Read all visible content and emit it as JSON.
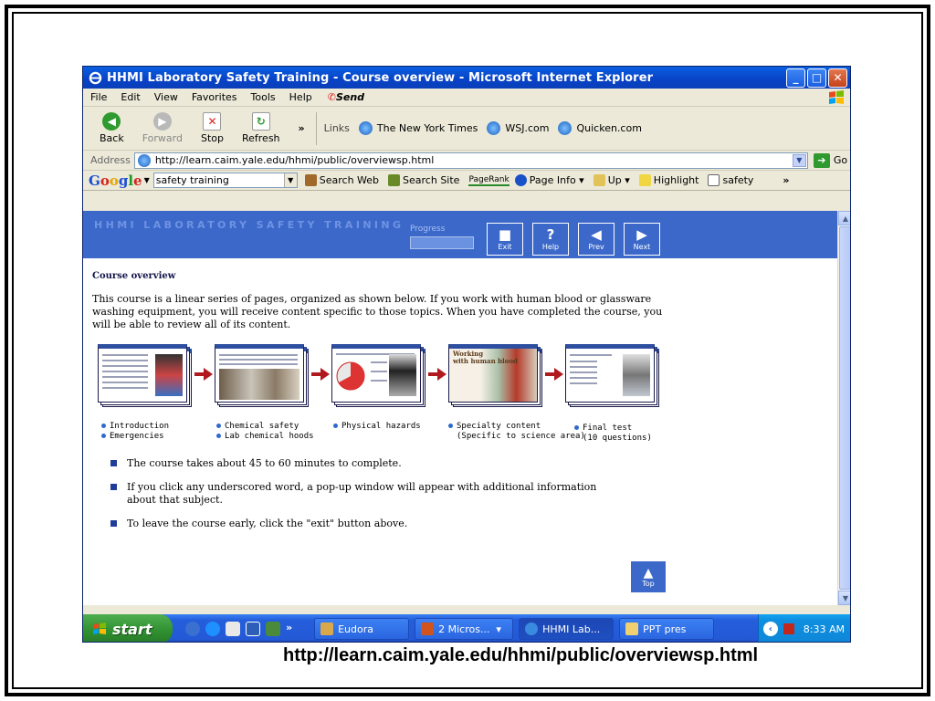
{
  "window": {
    "title": "HHMI Laboratory Safety Training - Course overview - Microsoft Internet Explorer",
    "controls": {
      "minimize": "_",
      "maximize": "□",
      "close": "✕"
    }
  },
  "menubar": {
    "items": [
      "File",
      "Edit",
      "View",
      "Favorites",
      "Tools",
      "Help"
    ],
    "send": "Send"
  },
  "toolbar": {
    "back": "Back",
    "forward": "Forward",
    "stop": "Stop",
    "refresh": "Refresh",
    "more": "»",
    "links_label": "Links",
    "links": [
      "The New York Times",
      "WSJ.com",
      "Quicken.com"
    ]
  },
  "address": {
    "label": "Address",
    "url": "http://learn.caim.yale.edu/hhmi/public/overviewsp.html",
    "go": "Go"
  },
  "google": {
    "logo": [
      "G",
      "o",
      "o",
      "g",
      "l",
      "e"
    ],
    "query": "safety training",
    "search_web": "Search Web",
    "search_site": "Search Site",
    "pagerank": "PageRank",
    "page_info": "Page Info",
    "up": "Up",
    "highlight": "Highlight",
    "keyword": "safety",
    "more": "»"
  },
  "course": {
    "header_title": "HHMI LABORATORY SAFETY TRAINING",
    "progress_label": "Progress",
    "progress_value": 0,
    "nav": [
      {
        "label": "Exit",
        "glyph": "■"
      },
      {
        "label": "Help",
        "glyph": "?"
      },
      {
        "label": "Prev",
        "glyph": "◀"
      },
      {
        "label": "Next",
        "glyph": "▶"
      }
    ],
    "overview_title": "Course overview",
    "intro": "This course is a linear series of pages, organized as shown below. If you work with human blood or glassware washing equipment, you will receive content specific to those topics. When you have completed the course, you will be able to review all of its content.",
    "flow": [
      {
        "lines": [
          "Introduction",
          "Emergencies"
        ]
      },
      {
        "lines": [
          "Chemical safety",
          "Lab chemical hoods"
        ]
      },
      {
        "lines": [
          "Physical hazards"
        ]
      },
      {
        "lines": [
          "Specialty content",
          "(Specific to science area)"
        ],
        "thumb_text": [
          "Working",
          "with human blood"
        ]
      },
      {
        "lines": [
          "Final test",
          "(10 questions)"
        ]
      }
    ],
    "bullets": [
      "The course takes about 45 to 60 minutes to complete.",
      "If you click any underscored word, a pop-up window will appear with additional information about that subject.",
      "To leave the course early, click the \"exit\" button above."
    ],
    "top_label": "Top"
  },
  "taskbar": {
    "start": "start",
    "more": "»",
    "tasks": [
      "Eudora",
      "2 Micros...",
      "HHMI Lab...",
      "PPT pres"
    ],
    "tray_chevron": "‹",
    "time": "8:33 AM"
  },
  "caption": "http://learn.caim.yale.edu/hhmi/public/overviewsp.html",
  "colors": {
    "course_header": "#3b68c9",
    "bullet": "#1f3c99",
    "arrow": "#b0191e",
    "taskbar": "#245edb",
    "start": "#2f8f2f"
  }
}
